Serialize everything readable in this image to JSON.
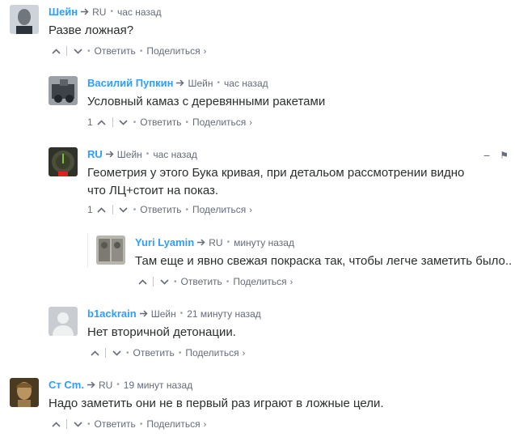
{
  "comments": [
    {
      "author": "Шейн",
      "reply_to": "RU",
      "time": "час назад",
      "text": "Разве ложная?",
      "upvotes": "",
      "reply_label": "Ответить",
      "share_label": "Поделиться",
      "avatar_color": "#4b5560"
    },
    {
      "author": "Василий Пупкин",
      "reply_to": "Шейн",
      "time": "час назад",
      "text": "Условный камаз с деревянными ракетами",
      "upvotes": "1",
      "reply_label": "Ответить",
      "share_label": "Поделиться",
      "avatar_color": "#5a5f66"
    },
    {
      "author": "RU",
      "reply_to": "Шейн",
      "time": "час назад",
      "text": "Геометрия у этого Бука кривая, при детальом рассмотрении видно что ЛЦ+стоит на показ.",
      "upvotes": "1",
      "reply_label": "Ответить",
      "share_label": "Поделиться",
      "avatar_color": "#3a3d33",
      "tools": {
        "collapse": "−",
        "flag": "⚑"
      }
    },
    {
      "author": "Yuri Lyamin",
      "reply_to": "RU",
      "time": "минуту назад",
      "text": "Там еще и явно свежая покраска так, чтобы легче заметить было..",
      "upvotes": "",
      "reply_label": "Ответить",
      "share_label": "Поделиться",
      "avatar_color": "#8c8a85"
    },
    {
      "author": "b1ackrain",
      "reply_to": "Шейн",
      "time": "21 минуту назад",
      "text": "Нет вторичной детонации.",
      "upvotes": "",
      "reply_label": "Ответить",
      "share_label": "Поделиться",
      "avatar_color": "#c9ccd1"
    },
    {
      "author": "Ст Cm.",
      "reply_to": "RU",
      "time": "19 минут назад",
      "text": "Надо заметить они не в первый раз играют в ложные цели.",
      "upvotes": "",
      "reply_label": "Ответить",
      "share_label": "Поделиться",
      "avatar_color": "#8a6a3c"
    }
  ],
  "colors": {
    "author": "#2e9fff",
    "meta": "#656c7a",
    "text": "#2a2e2e"
  }
}
